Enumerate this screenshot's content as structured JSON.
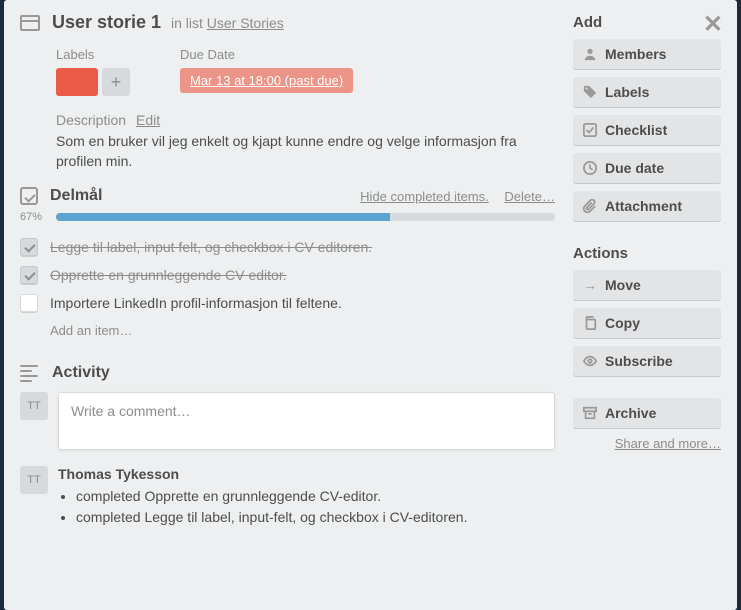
{
  "card": {
    "title": "User storie 1",
    "inlist_prefix": "in list",
    "list_name": "User Stories"
  },
  "labels": {
    "heading": "Labels",
    "color": "#eb5a46",
    "add_glyph": "+"
  },
  "due": {
    "heading": "Due Date",
    "text": "Mar 13 at 18:00 (past due)"
  },
  "description": {
    "heading": "Description",
    "edit_label": "Edit",
    "text": "Som en bruker vil jeg enkelt og kjapt kunne endre og velge informasjon fra profilen min."
  },
  "checklist": {
    "title": "Delmål",
    "hide_label": "Hide completed items.",
    "delete_label": "Delete…",
    "percent_label": "67%",
    "percent_value": 67,
    "items": [
      {
        "text": "Legge til label, input felt, og checkbox i CV editoren.",
        "done": true
      },
      {
        "text": "Opprette en grunnleggende CV editor.",
        "done": true
      },
      {
        "text": "Importere LinkedIn profil-informasjon til feltene.",
        "done": false
      }
    ],
    "add_item_placeholder": "Add an item…"
  },
  "activity": {
    "title": "Activity",
    "avatar_initials": "TT",
    "comment_placeholder": "Write a comment…",
    "entry": {
      "author": "Thomas Tykesson",
      "lines": [
        "completed Opprette en grunnleggende CV-editor.",
        "completed Legge til label, input-felt, og checkbox i CV-editoren."
      ]
    }
  },
  "sidebar": {
    "add": {
      "heading": "Add",
      "members": "Members",
      "labels": "Labels",
      "checklist": "Checklist",
      "due_date": "Due date",
      "attachment": "Attachment"
    },
    "actions": {
      "heading": "Actions",
      "move": "Move",
      "copy": "Copy",
      "subscribe": "Subscribe",
      "archive": "Archive"
    },
    "share_link": "Share and more…"
  }
}
